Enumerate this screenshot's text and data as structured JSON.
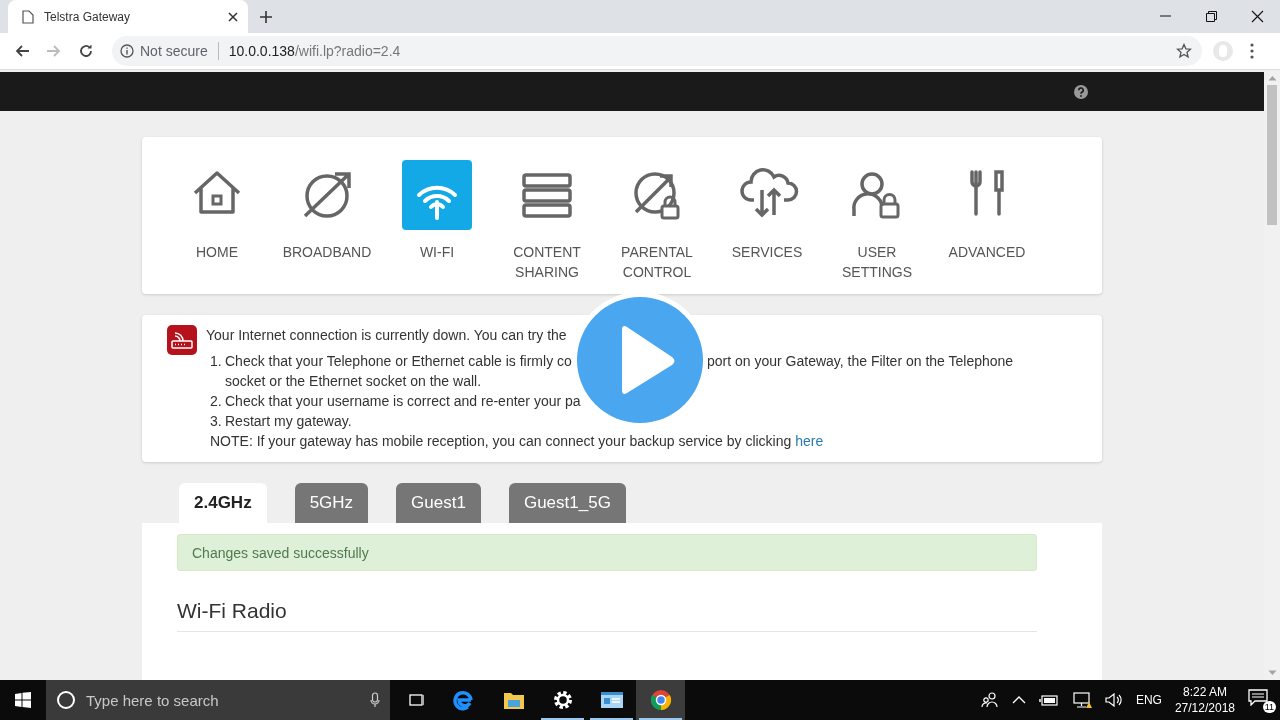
{
  "browser": {
    "tab_title": "Telstra Gateway",
    "security": "Not secure",
    "url_host": "10.0.0.138",
    "url_path": "/wifi.lp?radio=2.4",
    "nav_buttons": [
      {
        "kind": "back",
        "disabled": false
      },
      {
        "kind": "forward",
        "disabled": true
      },
      {
        "kind": "reload",
        "disabled": false
      }
    ]
  },
  "nav": [
    {
      "label": "HOME",
      "kind": "home",
      "selected": false
    },
    {
      "label": "BROADBAND",
      "kind": "broadband",
      "selected": false
    },
    {
      "label": "WI-FI",
      "kind": "wifi",
      "selected": true
    },
    {
      "label": "CONTENT SHARING",
      "kind": "content",
      "selected": false
    },
    {
      "label": "PARENTAL CONTROL",
      "kind": "parental",
      "selected": false
    },
    {
      "label": "SERVICES",
      "kind": "services",
      "selected": false
    },
    {
      "label": "USER SETTINGS",
      "kind": "user",
      "selected": false
    },
    {
      "label": "ADVANCED",
      "kind": "advanced",
      "selected": false
    }
  ],
  "message": {
    "intro": "Your Internet connection is currently down. You can try the",
    "steps": [
      {
        "number": "1.",
        "text": "Check that your Telephone or Ethernet cable is firmly co",
        "text_after": "port on your Gateway, the Filter on the Telephone",
        "continuation": "socket or the Ethernet socket on the wall."
      },
      {
        "number": "2.",
        "text": "Check that your username is correct and re-enter your pa"
      },
      {
        "number": "3.",
        "text": "Restart my gateway."
      }
    ],
    "note": "NOTE: If your gateway has mobile reception, you can connect your backup service by clicking",
    "note_link": "here"
  },
  "tabs": [
    {
      "label": "2.4GHz",
      "selected": true
    },
    {
      "label": "5GHz",
      "selected": false
    },
    {
      "label": "Guest1",
      "selected": false
    },
    {
      "label": "Guest1_5G",
      "selected": false
    }
  ],
  "panel": {
    "alert": "Changes saved successfully",
    "heading": "Wi-Fi Radio"
  },
  "taskbar": {
    "search_placeholder": "Type here to search",
    "apps": [
      {
        "kind": "taskview",
        "running": false,
        "active": false
      },
      {
        "kind": "edge",
        "running": false,
        "active": false
      },
      {
        "kind": "explorer",
        "running": false,
        "active": false
      },
      {
        "kind": "settings",
        "running": true,
        "active": false
      },
      {
        "kind": "app",
        "running": true,
        "active": false
      },
      {
        "kind": "chrome",
        "running": true,
        "active": true
      }
    ],
    "language": "ENG",
    "time": "8:22 AM",
    "date": "27/12/2018",
    "notifications": "11"
  }
}
